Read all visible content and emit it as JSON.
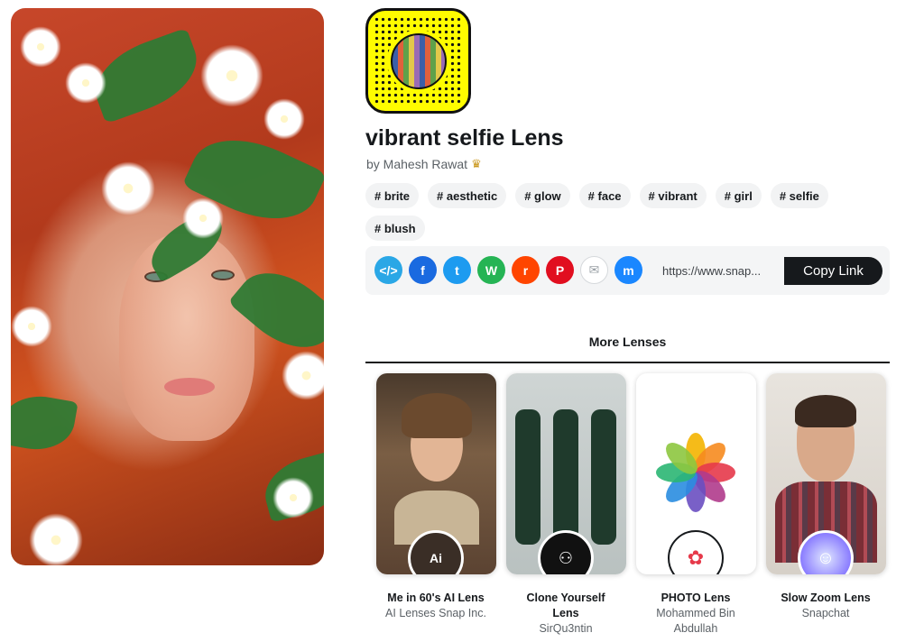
{
  "lens": {
    "title": "vibrant selfie Lens",
    "author": "by Mahesh Rawat",
    "author_badge_icon": "crown-icon"
  },
  "tags": [
    "# brite",
    "# aesthetic",
    "# glow",
    "# face",
    "# vibrant",
    "# girl",
    "# selfie",
    "# blush"
  ],
  "share": {
    "icons": [
      {
        "name": "embed-icon",
        "color": "#2aa7e6",
        "glyph": "</>"
      },
      {
        "name": "facebook-icon",
        "color": "#1a6ae0",
        "glyph": "f"
      },
      {
        "name": "twitter-icon",
        "color": "#1d9bf0",
        "glyph": "t"
      },
      {
        "name": "whatsapp-icon",
        "color": "#25b454",
        "glyph": "W"
      },
      {
        "name": "reddit-icon",
        "color": "#ff4500",
        "glyph": "r"
      },
      {
        "name": "pinterest-icon",
        "color": "#e10e1f",
        "glyph": "P"
      },
      {
        "name": "email-icon",
        "color": "#ffffff",
        "glyph": "✉"
      },
      {
        "name": "messenger-icon",
        "color": "#1a87ff",
        "glyph": "m"
      }
    ],
    "link": "https://www.snap...",
    "copy_label": "Copy Link"
  },
  "more_lenses": {
    "heading": "More Lenses",
    "cards": [
      {
        "name": "Me in 60's AI Lens",
        "author": "AI Lenses Snap Inc."
      },
      {
        "name": "Clone Yourself Lens",
        "author": "SirQu3ntin"
      },
      {
        "name": "PHOTO Lens",
        "author": "Mohammed Bin Abdullah"
      },
      {
        "name": "Slow Zoom Lens",
        "author": "Snapchat"
      }
    ]
  },
  "colors": {
    "snap_yellow": "#fffc00",
    "text_dark": "#16191c",
    "tag_bg": "#f2f3f4"
  }
}
